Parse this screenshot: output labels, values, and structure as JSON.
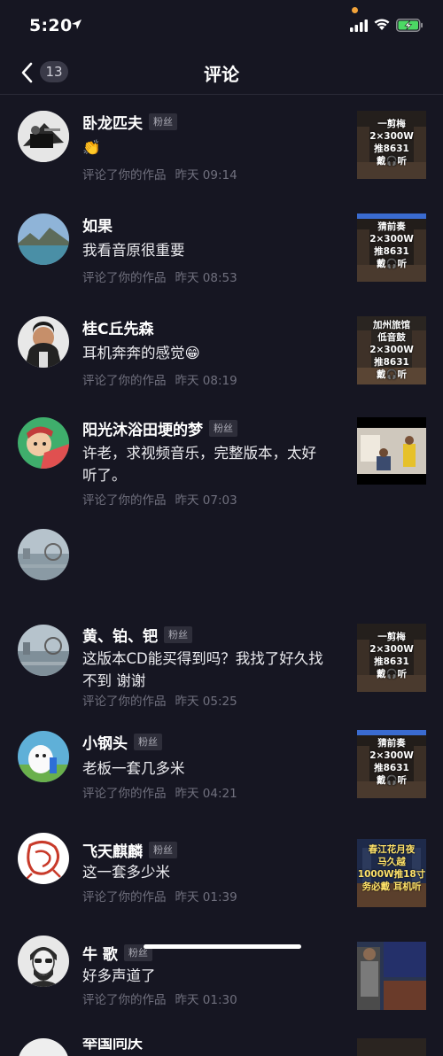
{
  "status_bar": {
    "time": "5:20"
  },
  "nav": {
    "back_count": "13",
    "title": "评论"
  },
  "comments": [
    {
      "name": "卧龙匹夫",
      "badge": "粉丝",
      "text": "👏",
      "action": "评论了你的作品",
      "time": "昨天 09:14",
      "thumb_lines": [
        "一剪梅",
        "2×300W",
        "推8631",
        "戴🎧听"
      ]
    },
    {
      "name": "如果",
      "badge": "",
      "text": "我看音原很重要",
      "action": "评论了你的作品",
      "time": "昨天 08:53",
      "thumb_lines": [
        "猜前奏",
        "2×300W",
        "推8631",
        "戴🎧听"
      ]
    },
    {
      "name": "桂C丘先森",
      "badge": "",
      "text": "耳机奔奔的感觉😁",
      "action": "评论了你的作品",
      "time": "昨天 08:19",
      "thumb_lines": [
        "加州旅馆",
        "低音鼓",
        "2×300W",
        "推8631",
        "戴🎧听"
      ]
    },
    {
      "name": "阳光沐浴田埂的梦",
      "badge": "粉丝",
      "text": "许老，求视频音乐，完整版本，太好听了。",
      "action": "评论了你的作品",
      "time": "昨天 07:03",
      "thumb_lines": []
    },
    {
      "name": "黄、铂、钯",
      "badge": "粉丝",
      "text": "这版本CD能买得到吗？我找了好久找不到 谢谢",
      "action": "评论了你的作品",
      "time": "昨天 05:25",
      "thumb_lines": [
        "一剪梅",
        "2×300W",
        "推8631",
        "戴🎧听"
      ]
    },
    {
      "name": "小钢头",
      "badge": "粉丝",
      "text": "老板一套几多米",
      "action": "评论了你的作品",
      "time": "昨天 04:21",
      "thumb_lines": [
        "猜前奏",
        "2×300W",
        "推8631",
        "戴🎧听"
      ]
    },
    {
      "name": "飞天麒麟",
      "badge": "粉丝",
      "text": "这一套多少米",
      "action": "评论了你的作品",
      "time": "昨天 01:39",
      "thumb_lines": [
        "春江花月夜",
        "马久越",
        "1000W推18寸",
        "务必戴 耳机听"
      ]
    },
    {
      "name": "牛 歌",
      "badge": "粉丝",
      "text": "好多声道了",
      "action": "评论了你的作品",
      "time": "昨天 01:30",
      "thumb_lines": []
    },
    {
      "name": "举国同庆",
      "badge": "",
      "text": "",
      "action": "",
      "time": "",
      "thumb_lines": []
    }
  ]
}
